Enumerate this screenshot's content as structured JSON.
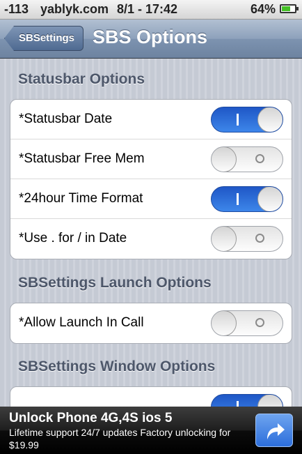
{
  "statusbar": {
    "signal": "-113",
    "carrier": "yablyk.com",
    "time": "8/1 - 17:42",
    "battery_pct": "64%",
    "battery_level": 0.64
  },
  "navbar": {
    "back_label": "SBSettings",
    "title": "SBS Options"
  },
  "sections": [
    {
      "title": "Statusbar Options",
      "rows": [
        {
          "label": "*Statusbar Date",
          "on": true
        },
        {
          "label": "*Statusbar Free Mem",
          "on": false
        },
        {
          "label": "*24hour Time Format",
          "on": true
        },
        {
          "label": "*Use . for / in Date",
          "on": false
        }
      ]
    },
    {
      "title": "SBSettings Launch Options",
      "rows": [
        {
          "label": "*Allow Launch In Call",
          "on": false
        }
      ]
    },
    {
      "title": "SBSettings Window Options",
      "rows": [
        {
          "label": "",
          "on": true
        }
      ]
    }
  ],
  "ad": {
    "title": "Unlock Phone 4G,4S ios 5",
    "body": "Lifetime support 24/7 updates Factory unlocking for $19.99",
    "button_icon": "share-arrow-icon"
  },
  "colors": {
    "toggle_on": "#2f70dd",
    "section_title": "#4d576a",
    "nav_bar": "#8da1bb"
  }
}
